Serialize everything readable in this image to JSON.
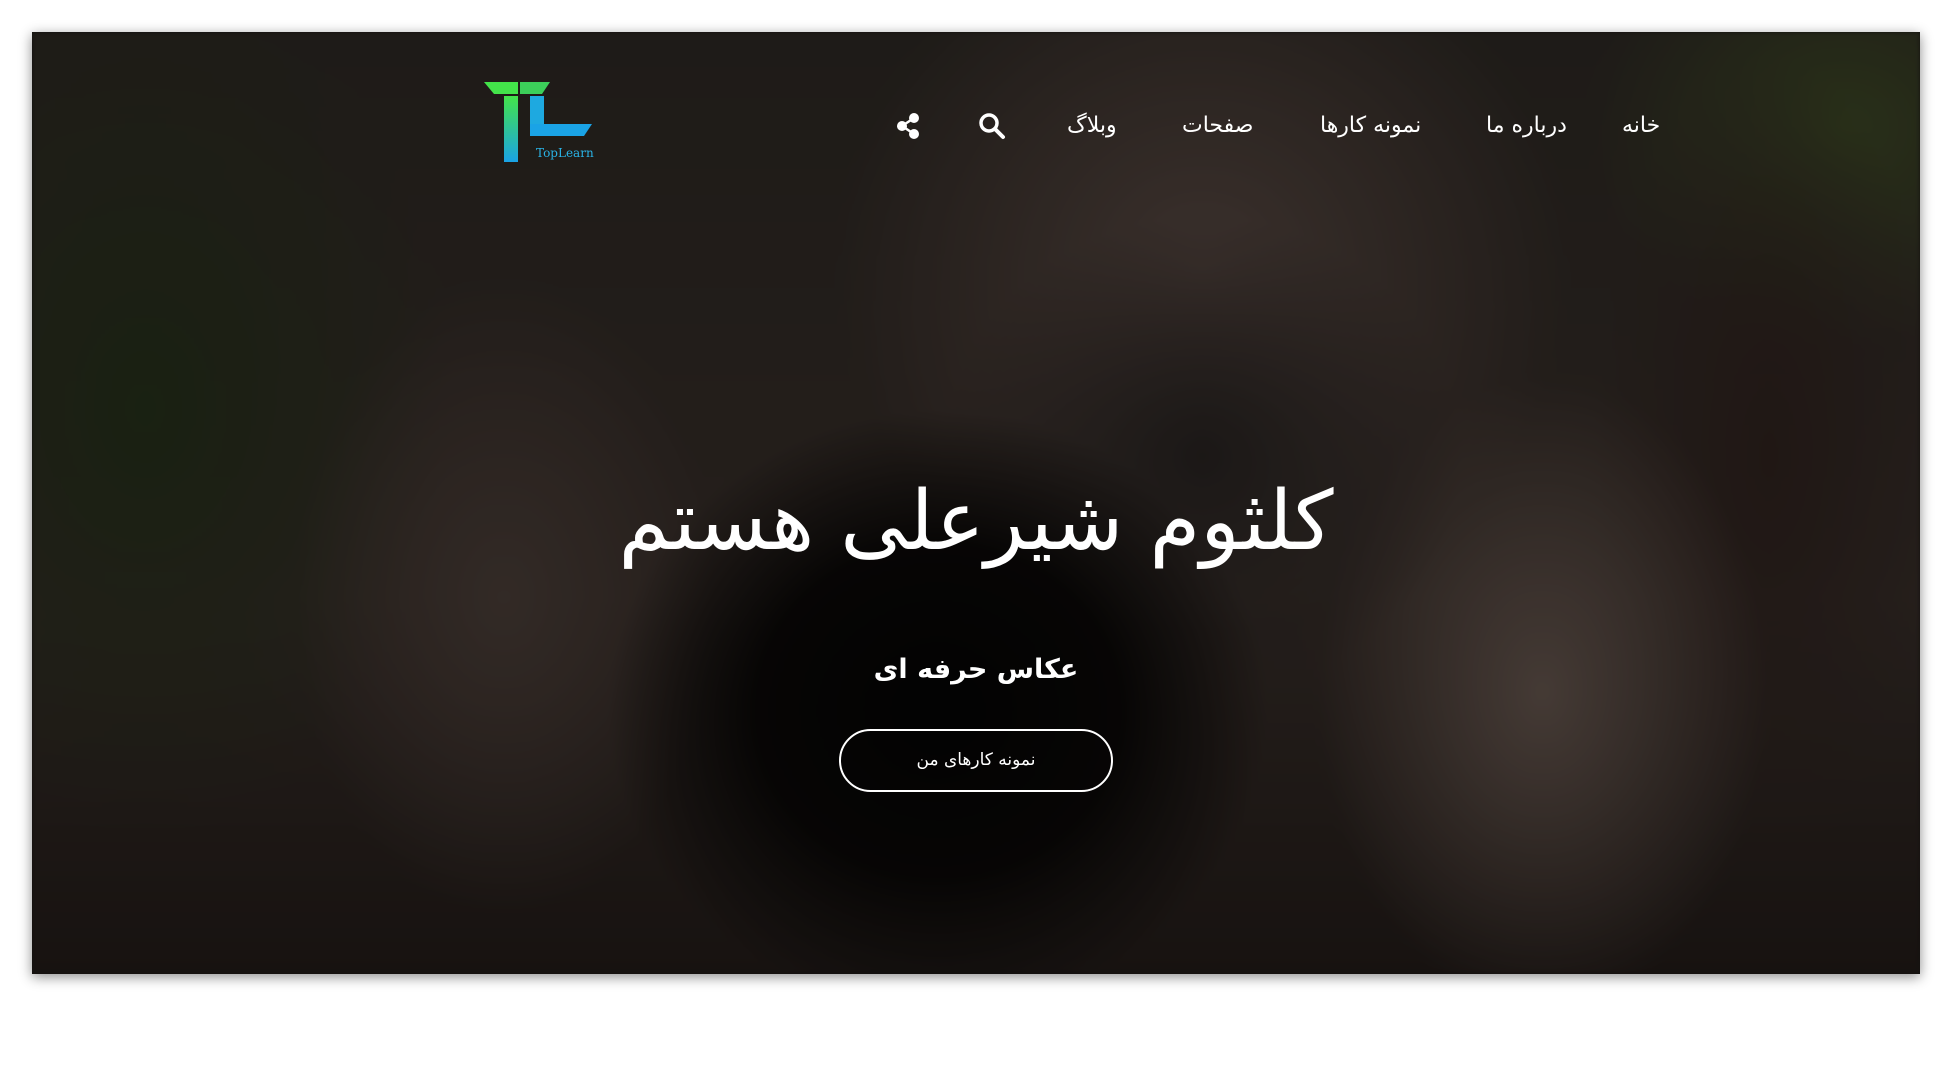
{
  "brand": {
    "logo_mark": "TL",
    "logo_text": "TopLearn",
    "colors": {
      "green": "#3ddc4f",
      "blue": "#1ea9e0"
    }
  },
  "nav": {
    "items": [
      {
        "label": "خانه"
      },
      {
        "label": "درباره ما"
      },
      {
        "label": "نمونه کارها"
      },
      {
        "label": "صفحات"
      },
      {
        "label": "وبلاگ"
      }
    ],
    "icons": [
      "search-icon",
      "share-icon"
    ]
  },
  "hero": {
    "title": "کلثوم شیرعلی هستم",
    "subtitle": "عکاس حرفه ای",
    "cta_label": "نمونه کارهای من",
    "overlay_color": "#000000"
  }
}
